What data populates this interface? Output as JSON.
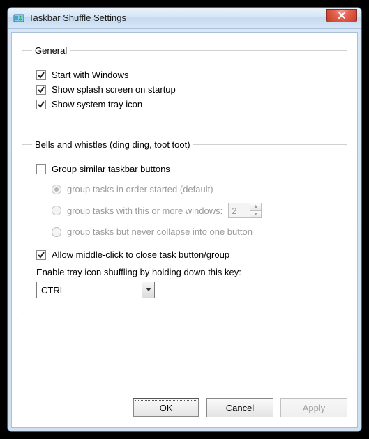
{
  "window": {
    "title": "Taskbar Shuffle Settings"
  },
  "general": {
    "legend": "General",
    "start_with_windows": {
      "label": "Start with Windows",
      "checked": true
    },
    "show_splash": {
      "label": "Show splash screen on startup",
      "checked": true
    },
    "show_tray_icon": {
      "label": "Show system tray icon",
      "checked": true
    }
  },
  "bells": {
    "legend": "Bells and whistles (ding ding, toot toot)",
    "group_similar": {
      "label": "Group similar taskbar buttons",
      "checked": false
    },
    "radios": {
      "enabled": false,
      "selected": "order",
      "order": "group tasks in order started (default)",
      "threshold": "group tasks with this or more windows:",
      "threshold_value": "2",
      "never_collapse": "group tasks but never collapse into one button"
    },
    "middle_click": {
      "label": "Allow middle-click to close task button/group",
      "checked": true
    },
    "tray_key_label": "Enable tray icon shuffling by holding down this key:",
    "tray_key_value": "CTRL"
  },
  "buttons": {
    "ok": "OK",
    "cancel": "Cancel",
    "apply": "Apply",
    "apply_enabled": false
  }
}
